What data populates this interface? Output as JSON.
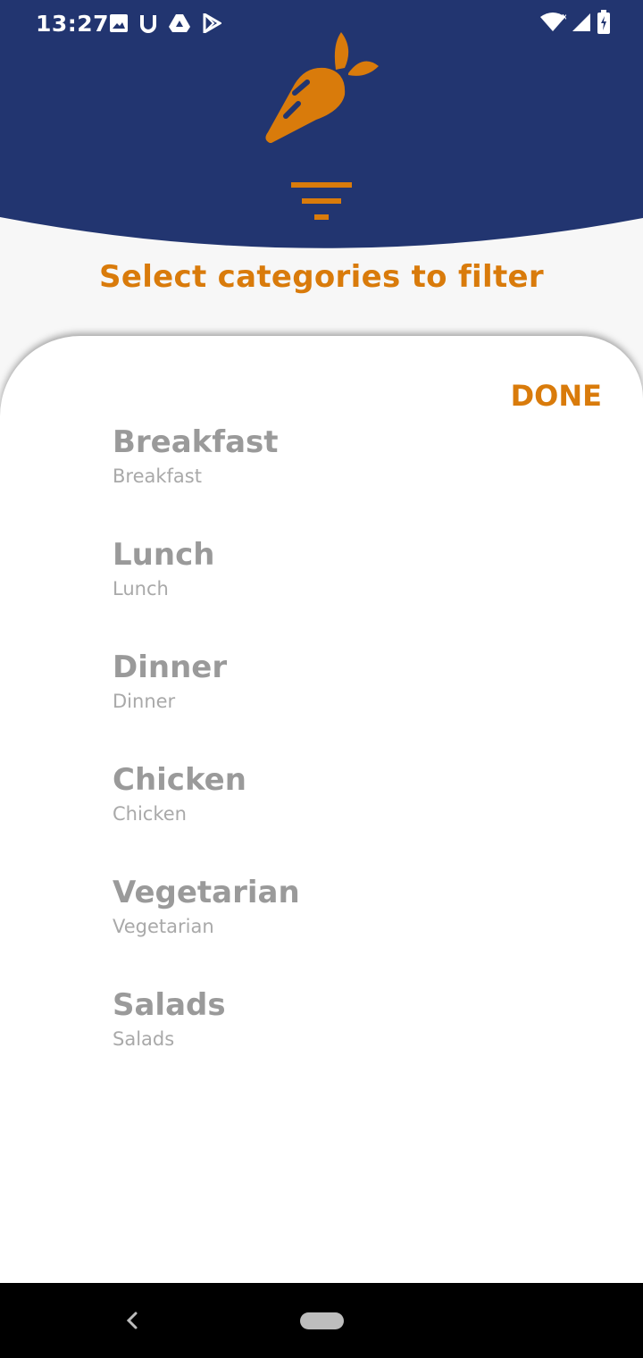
{
  "status_bar": {
    "time": "13:27",
    "left_icons": [
      "image-icon",
      "u-icon",
      "drive-icon",
      "play-store-icon"
    ],
    "right_icons": [
      "wifi-icon",
      "signal-icon",
      "battery-icon"
    ]
  },
  "header": {
    "bg_color": "#223570",
    "logo": "carrot-logo-icon",
    "filter_icon": "filter-icon",
    "subtitle": "Select categories to filter"
  },
  "sheet": {
    "done_label": "DONE",
    "categories": [
      {
        "title": "Breakfast",
        "subtitle": "Breakfast"
      },
      {
        "title": "Lunch",
        "subtitle": "Lunch"
      },
      {
        "title": "Dinner",
        "subtitle": "Dinner"
      },
      {
        "title": "Chicken",
        "subtitle": "Chicken"
      },
      {
        "title": "Vegetarian",
        "subtitle": "Vegetarian"
      },
      {
        "title": "Salads",
        "subtitle": "Salads"
      }
    ]
  },
  "colors": {
    "accent": "#d97b0b",
    "header": "#223570",
    "category_text": "#9a9a9a"
  },
  "nav_bar": {
    "icons": [
      "back-icon",
      "home-pill-icon"
    ]
  }
}
